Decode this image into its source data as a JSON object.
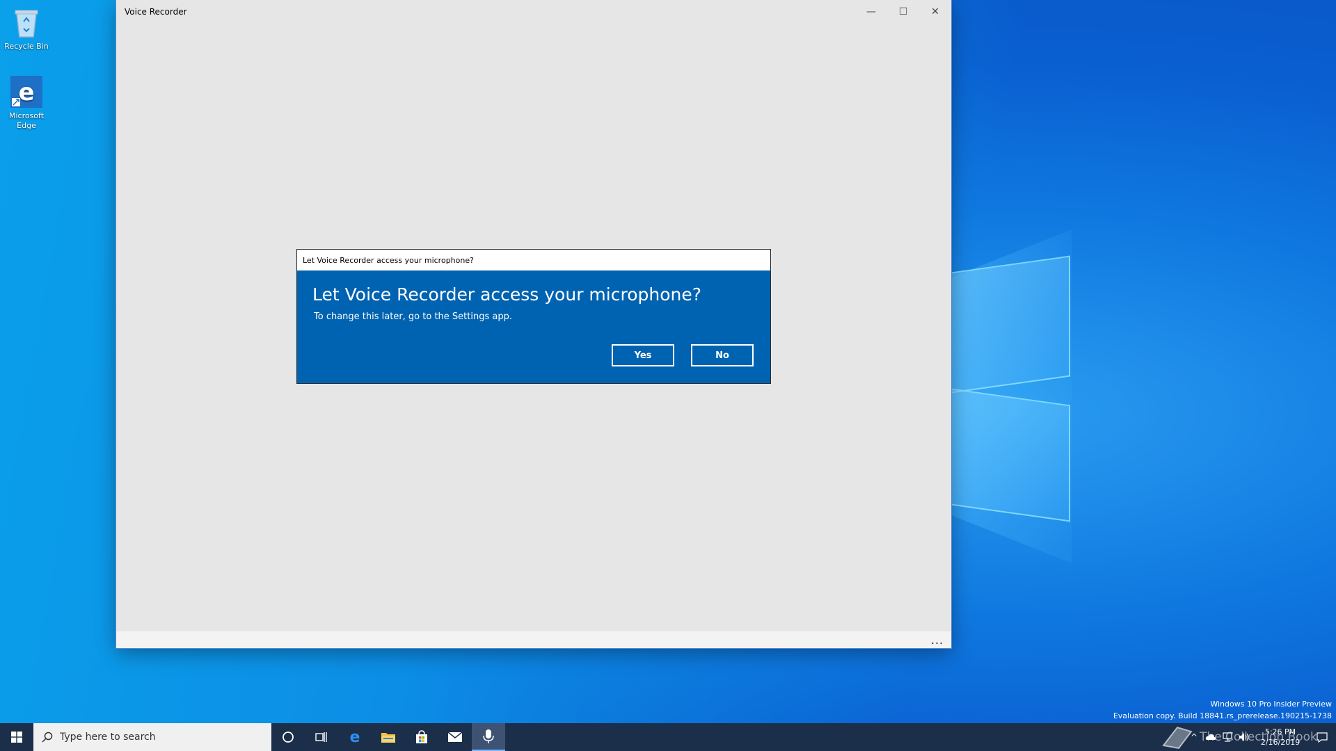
{
  "desktop": {
    "icons": [
      {
        "label": "Recycle Bin"
      },
      {
        "label": "Microsoft Edge"
      }
    ]
  },
  "app_window": {
    "title": "Voice Recorder",
    "minimize_glyph": "—",
    "maximize_glyph": "☐",
    "close_glyph": "✕",
    "more_glyph": "..."
  },
  "dialog": {
    "titlebar": "Let Voice Recorder access your microphone?",
    "heading": "Let Voice Recorder access your microphone?",
    "subtext": "To change this later, go to the Settings app.",
    "yes_label": "Yes",
    "no_label": "No"
  },
  "watermark": {
    "line1": "Windows 10 Pro Insider Preview",
    "line2": "Evaluation copy. Build 18841.rs_prerelease.190215-1738"
  },
  "taskbar": {
    "search_placeholder": "Type here to search",
    "clock_time": "5:26 PM",
    "clock_date": "2/16/2019",
    "brand": "The Collection Book"
  },
  "colors": {
    "dialog_bg": "#0063b1",
    "taskbar_bg": "#1b2e4a",
    "window_bg": "#e6e6e6"
  }
}
